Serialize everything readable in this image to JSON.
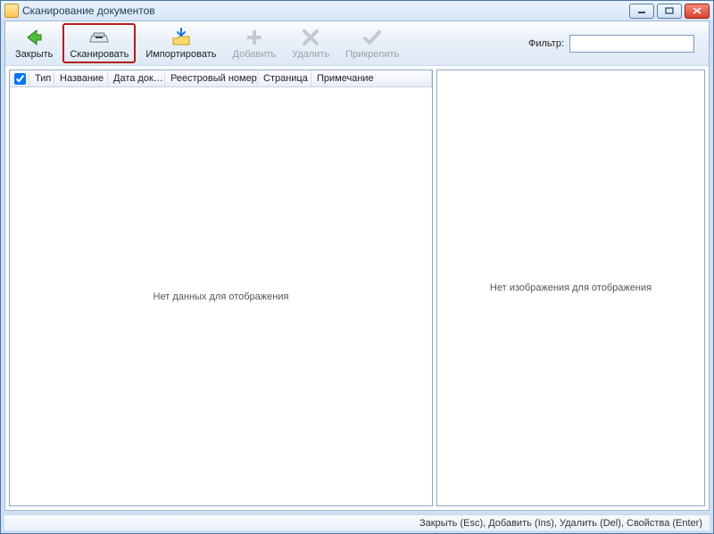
{
  "window": {
    "title": "Сканирование документов"
  },
  "toolbar": {
    "close": "Закрыть",
    "scan": "Сканировать",
    "import": "Импортировать",
    "add": "Добавить",
    "delete": "Удалить",
    "attach": "Прикрепить"
  },
  "filter": {
    "label": "Фильтр:",
    "value": ""
  },
  "columns": {
    "type": "Тип",
    "name": "Название",
    "doc_date": "Дата док…",
    "reg_number": "Реестровый номер",
    "page": "Страница",
    "note": "Примечание"
  },
  "empty": {
    "grid": "Нет данных для отображения",
    "preview": "Нет изображения для отображения"
  },
  "statusbar": "Закрыть (Esc), Добавить (Ins), Удалить (Del), Свойства (Enter)"
}
